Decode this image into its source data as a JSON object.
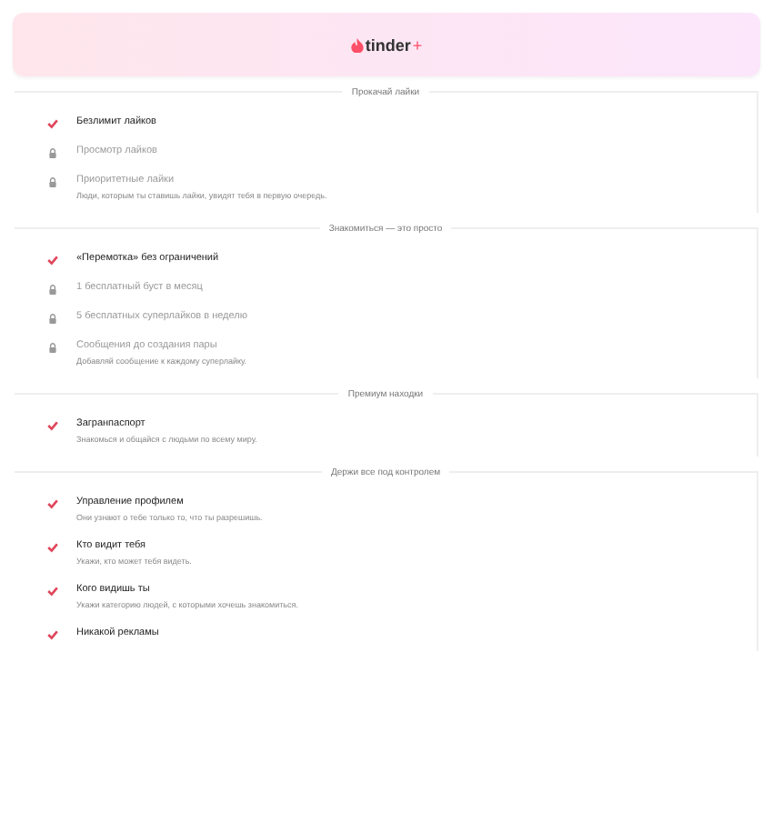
{
  "header": {
    "logo_name": "tinder",
    "logo_suffix": "+"
  },
  "sections": [
    {
      "title": "Прокачай лайки",
      "items": [
        {
          "title": "Безлимит лайков",
          "included": true
        },
        {
          "title": "Просмотр лайков",
          "included": false
        },
        {
          "title": "Приоритетные лайки",
          "description": "Люди, которым ты ставишь лайки, увидят тебя в первую очередь.",
          "included": false
        }
      ]
    },
    {
      "title": "Знакомиться — это просто",
      "items": [
        {
          "title": "«Перемотка» без ограничений",
          "included": true
        },
        {
          "title": "1 бесплатный буст в месяц",
          "included": false
        },
        {
          "title": "5 бесплатных суперлайков в неделю",
          "included": false
        },
        {
          "title": "Сообщения до создания пары",
          "description": "Добавляй сообщение к каждому суперлайку.",
          "included": false
        }
      ]
    },
    {
      "title": "Премиум находки",
      "items": [
        {
          "title": "Загранпаспорт",
          "description": "Знакомься и общайся с людьми по всему миру.",
          "included": true
        }
      ]
    },
    {
      "title": "Держи все под контролем",
      "items": [
        {
          "title": "Управление профилем",
          "description": "Они узнают о тебе только то, что ты разрешишь.",
          "included": true
        },
        {
          "title": "Кто видит тебя",
          "description": "Укажи, кто может тебя видеть.",
          "included": true
        },
        {
          "title": "Кого видишь ты",
          "description": "Укажи категорию людей, с которыми хочешь знакомиться.",
          "included": true
        },
        {
          "title": "Никакой рекламы",
          "included": true
        }
      ]
    }
  ]
}
